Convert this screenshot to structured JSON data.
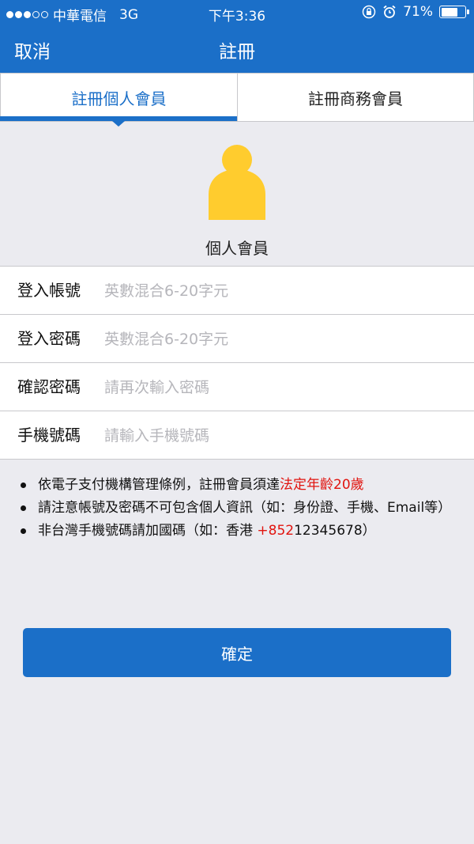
{
  "status_bar": {
    "carrier": "中華電信",
    "network": "3G",
    "time": "下午3:36",
    "battery": "71%",
    "battery_level": 0.71,
    "icons": [
      "lock-rotation-icon",
      "alarm-icon",
      "battery-icon"
    ]
  },
  "nav": {
    "cancel": "取消",
    "title": "註冊"
  },
  "tabs": [
    {
      "label": "註冊個人會員",
      "active": true
    },
    {
      "label": "註冊商務會員",
      "active": false
    }
  ],
  "profile": {
    "label": "個人會員",
    "icon": "person-icon",
    "icon_color": "#ffcc2e"
  },
  "form": {
    "fields": [
      {
        "label": "登入帳號",
        "placeholder": "英數混合6-20字元",
        "value": ""
      },
      {
        "label": "登入密碼",
        "placeholder": "英數混合6-20字元",
        "value": ""
      },
      {
        "label": "確認密碼",
        "placeholder": "請再次輸入密碼",
        "value": ""
      },
      {
        "label": "手機號碼",
        "placeholder": "請輸入手機號碼",
        "value": ""
      }
    ]
  },
  "notes": [
    {
      "text": "依電子支付機構管理條例，註冊會員須達",
      "highlight": "法定年齡20歲",
      "suffix": ""
    },
    {
      "text": "請注意帳號及密碼不可包含個人資訊（如：身份證、手機、Email等）",
      "highlight": "",
      "suffix": ""
    },
    {
      "text": "非台灣手機號碼請加國碼（如：香港 ",
      "highlight": "+852",
      "suffix": "12345678）"
    }
  ],
  "confirm_button": "確定",
  "colors": {
    "primary": "#1b6fc8",
    "highlight": "#e1140f",
    "background": "#ebebf0"
  }
}
